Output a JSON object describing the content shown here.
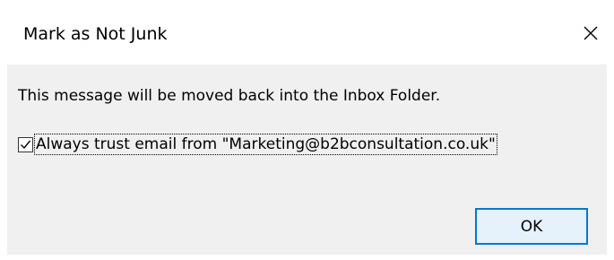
{
  "dialog": {
    "title": "Mark as Not Junk",
    "close_icon": "close-icon",
    "message": "This message will be moved back into the Inbox Folder.",
    "checkbox": {
      "checked": true,
      "label": "Always trust email from \"Marketing@b2bconsultation.co.uk\""
    },
    "ok_label": "OK"
  },
  "colors": {
    "dialog_body_bg": "#f0f0f0",
    "titlebar_bg": "#ffffff",
    "button_border": "#0078d7",
    "button_bg": "#e5f1fb"
  }
}
